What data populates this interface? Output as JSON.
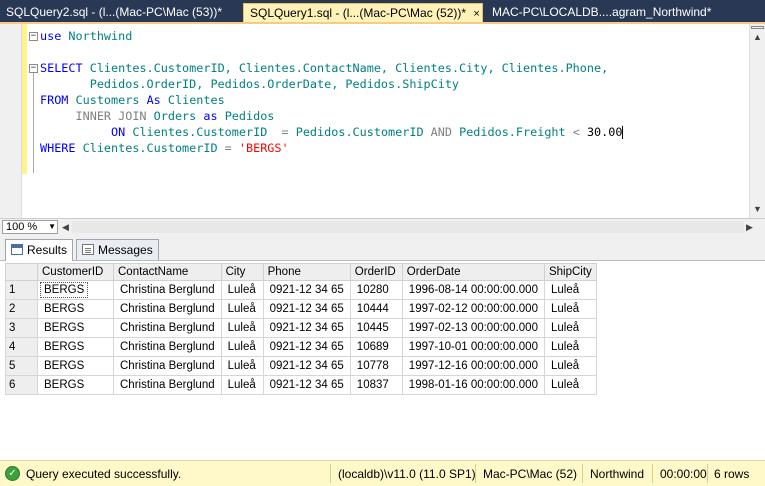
{
  "tabs": [
    {
      "label": "SQLQuery2.sql - (l...(Mac-PC\\Mac (53))*",
      "active": false
    },
    {
      "label": "SQLQuery1.sql - (l...(Mac-PC\\Mac (52))*",
      "active": true,
      "close": "×"
    },
    {
      "label": "MAC-PC\\LOCALDB....agram_Northwind*",
      "active": false
    }
  ],
  "editor": {
    "line1": {
      "kw": "use",
      "rest": " Northwind"
    },
    "sql": {
      "select": "SELECT",
      "cols1": " Clientes.CustomerID, Clientes.ContactName, Clientes.City, Clientes.Phone,",
      "cols2": "       Pedidos.OrderID, Pedidos.OrderDate, Pedidos.ShipCity",
      "from": "FROM",
      "from_rest": " Customers ",
      "as1": "As",
      "from_alias": " Clientes",
      "inner": "INNER JOIN",
      "join_rest": " Orders ",
      "as2": "as",
      "join_alias": " Pedidos",
      "on": "ON",
      "on_left": " Clientes.CustomerID  ",
      "eq": "=",
      "on_mid": " Pedidos.CustomerID ",
      "and": "AND",
      "on_right": " Pedidos.Freight ",
      "lt": "<",
      "num": " 30.00",
      "where": "WHERE",
      "where_rest": " Clientes.CustomerID ",
      "eq2": "=",
      "str": " 'BERGS'"
    }
  },
  "zoom": "100 %",
  "result_tabs": [
    "Results",
    "Messages"
  ],
  "grid": {
    "columns": [
      "CustomerID",
      "ContactName",
      "City",
      "Phone",
      "OrderID",
      "OrderDate",
      "ShipCity"
    ],
    "rows": [
      {
        "n": "1",
        "cells": [
          "BERGS",
          "Christina Berglund",
          "Luleå",
          "0921-12 34 65",
          "10280",
          "1996-08-14 00:00:00.000",
          "Luleå"
        ]
      },
      {
        "n": "2",
        "cells": [
          "BERGS",
          "Christina Berglund",
          "Luleå",
          "0921-12 34 65",
          "10444",
          "1997-02-12 00:00:00.000",
          "Luleå"
        ]
      },
      {
        "n": "3",
        "cells": [
          "BERGS",
          "Christina Berglund",
          "Luleå",
          "0921-12 34 65",
          "10445",
          "1997-02-13 00:00:00.000",
          "Luleå"
        ]
      },
      {
        "n": "4",
        "cells": [
          "BERGS",
          "Christina Berglund",
          "Luleå",
          "0921-12 34 65",
          "10689",
          "1997-10-01 00:00:00.000",
          "Luleå"
        ]
      },
      {
        "n": "5",
        "cells": [
          "BERGS",
          "Christina Berglund",
          "Luleå",
          "0921-12 34 65",
          "10778",
          "1997-12-16 00:00:00.000",
          "Luleå"
        ]
      },
      {
        "n": "6",
        "cells": [
          "BERGS",
          "Christina Berglund",
          "Luleå",
          "0921-12 34 65",
          "10837",
          "1998-01-16 00:00:00.000",
          "Luleå"
        ]
      }
    ]
  },
  "status": {
    "message": "Query executed successfully.",
    "server": "(localdb)\\v11.0 (11.0 SP1)",
    "user": "Mac-PC\\Mac (52)",
    "database": "Northwind",
    "time": "00:00:00",
    "rows": "6 rows"
  },
  "colors": {
    "tab_active": "#fff2b8",
    "chrome": "#293955",
    "status": "#fff8c8",
    "keyword": "#0000ff",
    "string": "#ff0000"
  }
}
